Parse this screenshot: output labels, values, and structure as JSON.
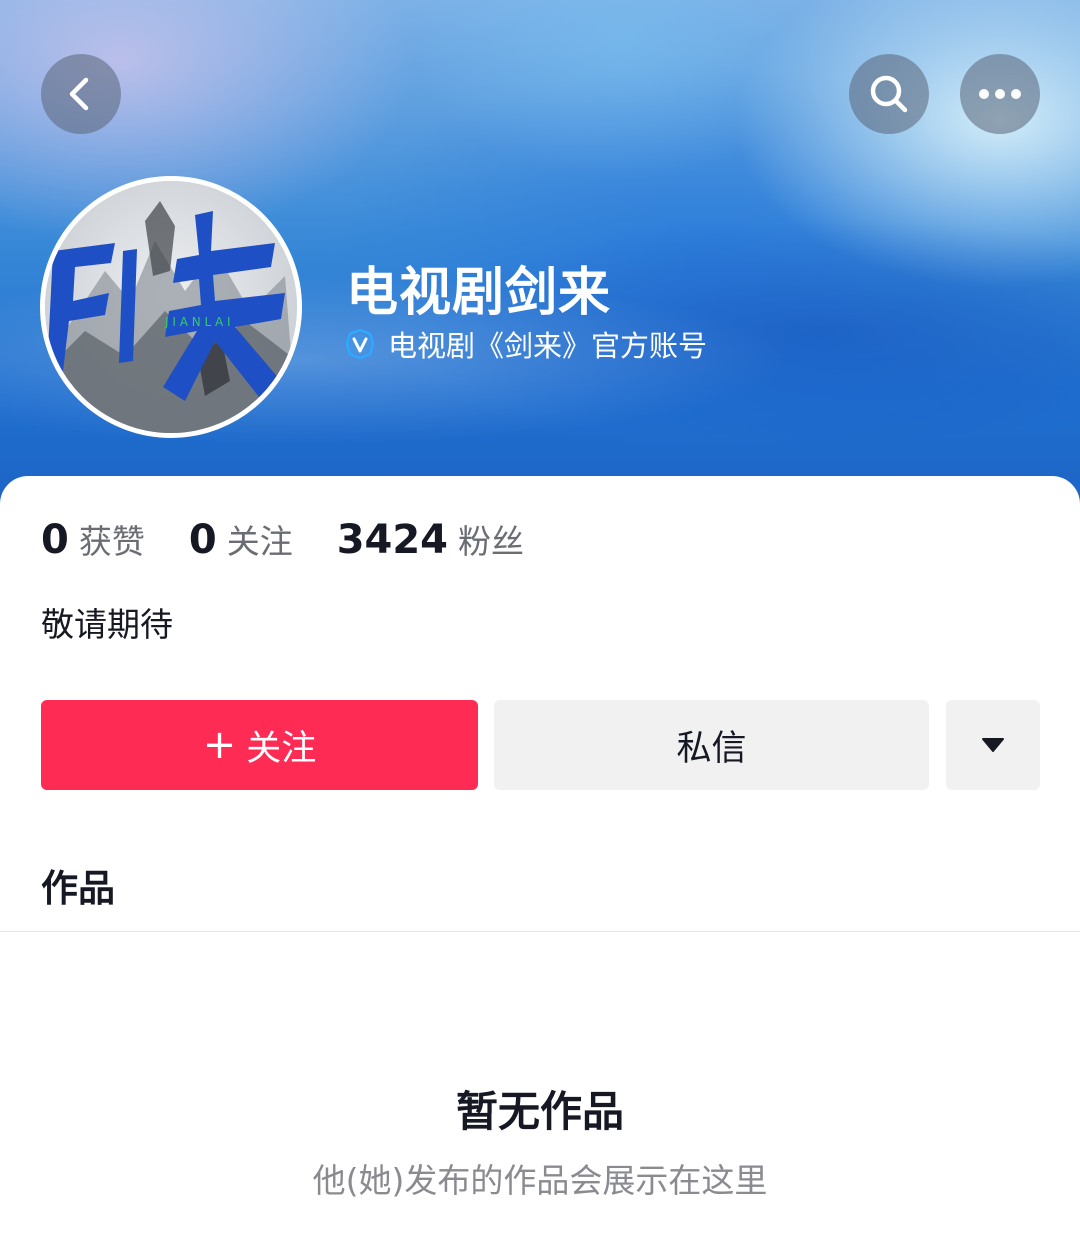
{
  "header": {
    "back_icon": "chevron-left-icon",
    "search_icon": "search-icon",
    "more_icon": "more-horizontal-icon"
  },
  "profile": {
    "avatar_text": "剑来",
    "nickname": "电视剧剑来",
    "verify_icon": "verified-v-icon",
    "verify_text": "电视剧《剑来》官方账号"
  },
  "stats": [
    {
      "value": "0",
      "label": "获赞"
    },
    {
      "value": "0",
      "label": "关注"
    },
    {
      "value": "3424",
      "label": "粉丝"
    }
  ],
  "bio": "敬请期待",
  "actions": {
    "follow_plus": "+",
    "follow_label": "关注",
    "message_label": "私信",
    "dropdown_icon": "caret-down-icon"
  },
  "tabs": {
    "works_label": "作品"
  },
  "empty_state": {
    "title": "暂无作品",
    "subtitle": "他(她)发布的作品会展示在这里"
  },
  "colors": {
    "accent": "#fe2c55",
    "secondary_button": "#f1f1f2"
  }
}
